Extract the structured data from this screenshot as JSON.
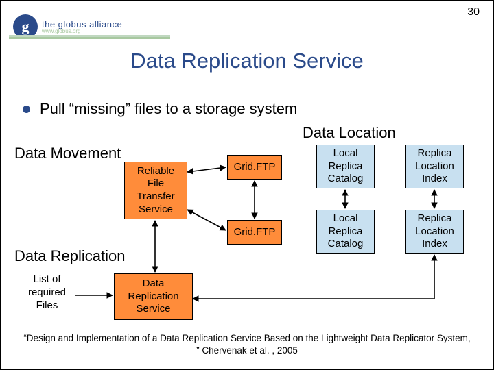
{
  "page_number": "30",
  "logo": {
    "brand": "the globus alliance",
    "url": "www.globus.org"
  },
  "title": "Data Replication Service",
  "bullet": "Pull “missing” files to a storage system",
  "sections": {
    "data_location": "Data Location",
    "data_movement": "Data Movement",
    "data_replication": "Data Replication"
  },
  "boxes": {
    "reliable": "Reliable\nFile\nTransfer\nService",
    "gridftp1": "Grid.FTP",
    "gridftp2": "Grid.FTP",
    "lrc1": "Local\nReplica\nCatalog",
    "lrc2": "Local\nReplica\nCatalog",
    "rli1": "Replica\nLocation\nIndex",
    "rli2": "Replica\nLocation\nIndex",
    "drs": "Data\nReplication\nService"
  },
  "side_label": "List of\nrequired\nFiles",
  "citation": "“Design and Implementation of a Data Replication Service Based on the Lightweight Data Replicator System, ” Chervenak et al. , 2005"
}
